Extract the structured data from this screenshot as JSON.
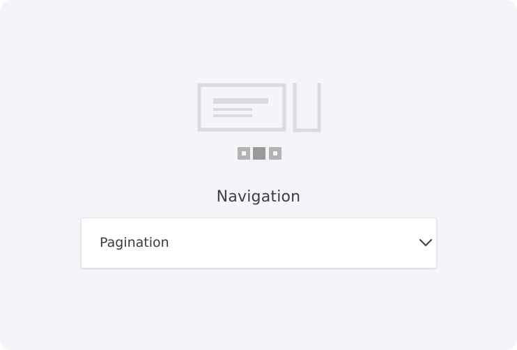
{
  "field": {
    "label": "Navigation",
    "selected_value": "Pagination",
    "icon": "chevron-down-icon"
  },
  "illustration": {
    "icon": "pagination-illustration-icon"
  },
  "colors": {
    "background": "#f4f5f8",
    "illustration": "#dadbdf",
    "pager_active": "#9a9a9a",
    "pager_inactive": "#b3b3b3",
    "text": "#3d3d42"
  }
}
